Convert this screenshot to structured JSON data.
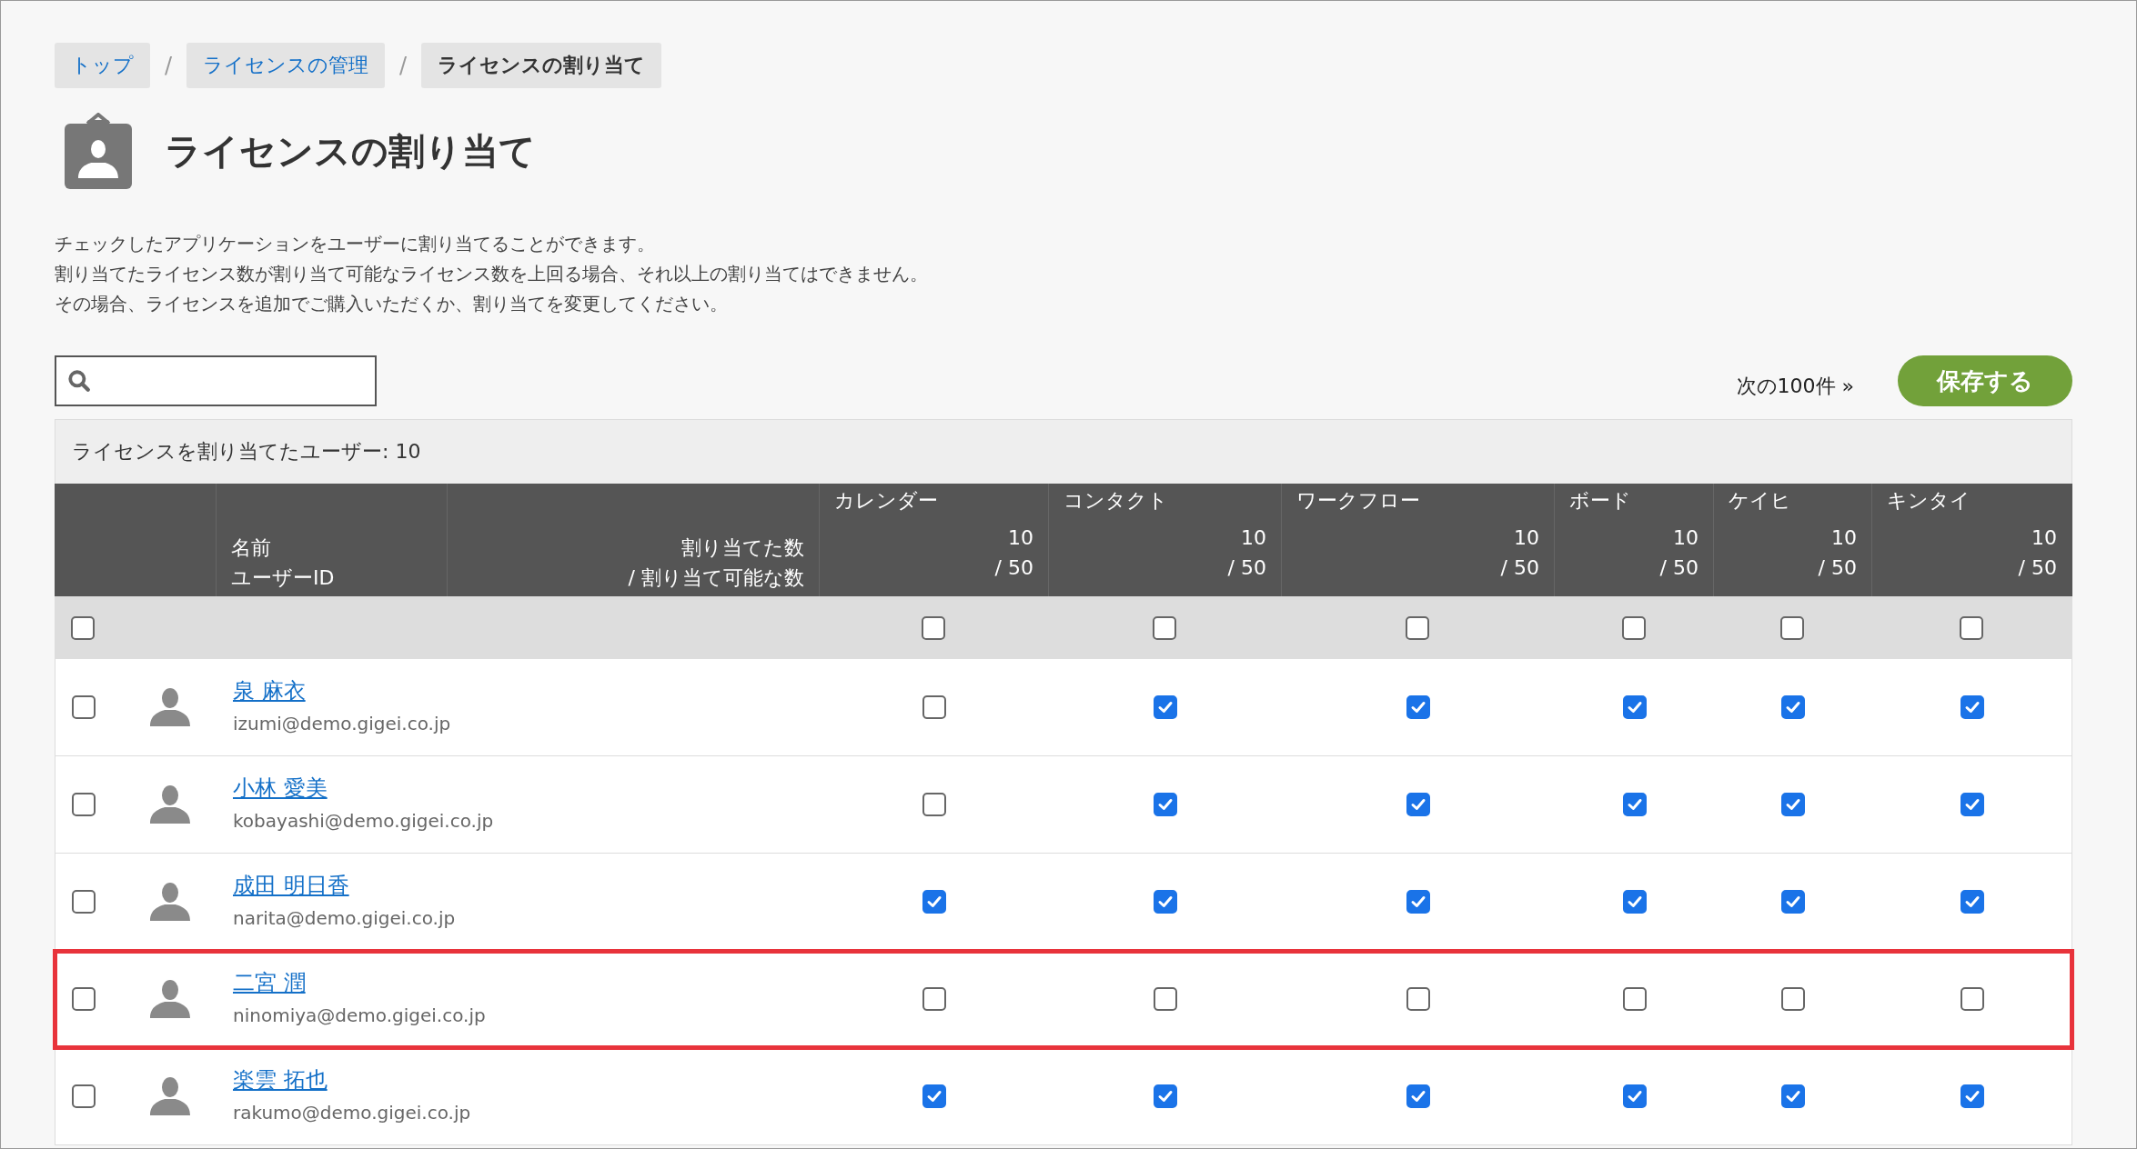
{
  "breadcrumb": [
    {
      "label": "トップ",
      "kind": "link"
    },
    {
      "label": "ライセンスの管理",
      "kind": "link"
    },
    {
      "label": "ライセンスの割り当て",
      "kind": "current"
    }
  ],
  "breadcrumb_separator": "/",
  "title": "ライセンスの割り当て",
  "description": [
    "チェックしたアプリケーションをユーザーに割り当てることができます。",
    "割り当てたライセンス数が割り当て可能なライセンス数を上回る場合、それ以上の割り当てはできません。",
    "その場合、ライセンスを追加でご購入いただくか、割り当てを変更してください。"
  ],
  "next_link": "次の100件 »",
  "save_button": "保存する",
  "assigned_count": "ライセンスを割り当てたユーザー: 10",
  "columns": {
    "name": "名前",
    "user_id": "ユーザーID",
    "assigned": "割り当てた数",
    "available": "/ 割り当て可能な数"
  },
  "apps": [
    {
      "name": "カレンダー",
      "assigned": "10",
      "available": "/ 50"
    },
    {
      "name": "コンタクト",
      "assigned": "10",
      "available": "/ 50"
    },
    {
      "name": "ワークフロー",
      "assigned": "10",
      "available": "/ 50"
    },
    {
      "name": "ボード",
      "assigned": "10",
      "available": "/ 50"
    },
    {
      "name": "ケイヒ",
      "assigned": "10",
      "available": "/ 50"
    },
    {
      "name": "キンタイ",
      "assigned": "10",
      "available": "/ 50"
    }
  ],
  "select_all": {
    "checked": false,
    "apps": [
      {
        "checked": false
      },
      {
        "checked": false
      },
      {
        "checked": false
      },
      {
        "checked": false
      },
      {
        "checked": false
      },
      {
        "checked": false
      }
    ]
  },
  "rows": [
    {
      "name": "泉 麻衣",
      "email": "izumi@demo.gigei.co.jp",
      "checked": false,
      "highlighted": false,
      "licenses": [
        {
          "checked": false
        },
        {
          "checked": true
        },
        {
          "checked": true
        },
        {
          "checked": true
        },
        {
          "checked": true
        },
        {
          "checked": true
        }
      ]
    },
    {
      "name": "小林 愛美",
      "email": "kobayashi@demo.gigei.co.jp",
      "checked": false,
      "highlighted": false,
      "licenses": [
        {
          "checked": false
        },
        {
          "checked": true
        },
        {
          "checked": true
        },
        {
          "checked": true
        },
        {
          "checked": true
        },
        {
          "checked": true
        }
      ]
    },
    {
      "name": "成田 明日香",
      "email": "narita@demo.gigei.co.jp",
      "checked": false,
      "highlighted": false,
      "licenses": [
        {
          "checked": true
        },
        {
          "checked": true
        },
        {
          "checked": true
        },
        {
          "checked": true
        },
        {
          "checked": true
        },
        {
          "checked": true
        }
      ]
    },
    {
      "name": "二宮 潤",
      "email": "ninomiya@demo.gigei.co.jp",
      "checked": false,
      "highlighted": true,
      "licenses": [
        {
          "checked": false
        },
        {
          "checked": false
        },
        {
          "checked": false
        },
        {
          "checked": false
        },
        {
          "checked": false
        },
        {
          "checked": false
        }
      ]
    },
    {
      "name": "楽雲 拓也",
      "email": "rakumo@demo.gigei.co.jp",
      "checked": false,
      "highlighted": false,
      "licenses": [
        {
          "checked": true
        },
        {
          "checked": true
        },
        {
          "checked": true
        },
        {
          "checked": true
        },
        {
          "checked": true
        },
        {
          "checked": true
        }
      ]
    }
  ]
}
